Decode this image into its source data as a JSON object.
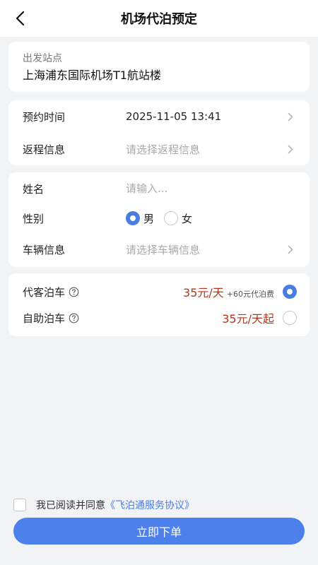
{
  "header": {
    "title": "机场代泊预定"
  },
  "station": {
    "label": "出发站点",
    "name": "上海浦东国际机场T1航站楼"
  },
  "booking": {
    "time_label": "预约时间",
    "time_value": "2025-11-05 13:41",
    "return_label": "返程信息",
    "return_placeholder": "请选择返程信息"
  },
  "info": {
    "name_label": "姓名",
    "name_placeholder": "请输入...",
    "name_value": "",
    "gender_label": "性别",
    "gender_options": [
      "男",
      "女"
    ],
    "gender_selected": "男",
    "vehicle_label": "车辆信息",
    "vehicle_placeholder": "请选择车辆信息"
  },
  "parking": {
    "valet_label": "代客泊车",
    "valet_price": "35元/天",
    "valet_extra": "+60元代泊费",
    "valet_selected": true,
    "self_label": "自助泊车",
    "self_price": "35元/天起",
    "self_selected": false
  },
  "agreement": {
    "checked": false,
    "text": "我已阅读并同意",
    "link": "《飞泊通服务协议》"
  },
  "submit": {
    "label": "立即下单"
  },
  "colors": {
    "accent": "#4a7de3",
    "price": "#b5361f",
    "background": "#f2f3f5"
  },
  "icons": {
    "back": "chevron-left-icon",
    "row_arrow": "chevron-right-icon",
    "help": "question-circle-icon"
  }
}
